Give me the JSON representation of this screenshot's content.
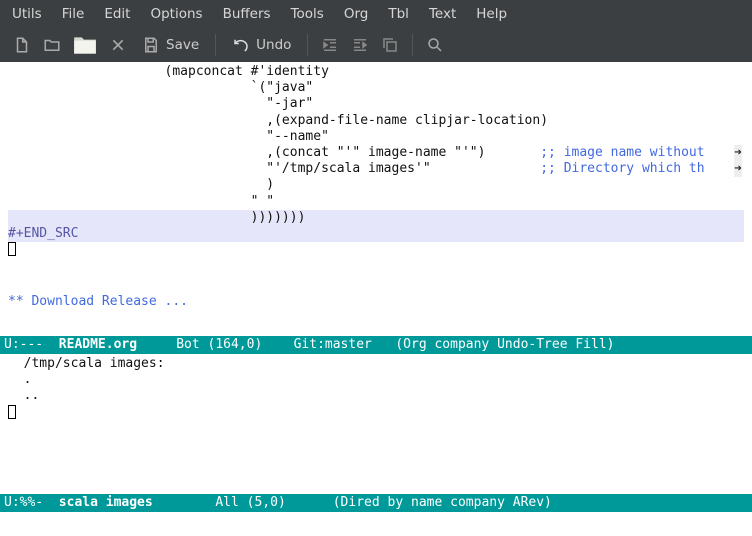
{
  "menubar": {
    "items": [
      "Utils",
      "File",
      "Edit",
      "Options",
      "Buffers",
      "Tools",
      "Org",
      "Tbl",
      "Text",
      "Help"
    ]
  },
  "toolbar": {
    "save_label": "Save",
    "undo_label": "Undo"
  },
  "buffer1": {
    "lines": [
      "                    (mapconcat #'identity",
      "                               `(\"java\"",
      "                                 \"-jar\"",
      "                                 ,(expand-file-name clipjar-location)",
      "                                 \"--name\"",
      "                                 ,(concat \"'\" image-name \"'\")       ;; image name without",
      "                                 \"'/tmp/scala images'\"              ;; Directory which th",
      "                                 )",
      "                               \" \"",
      "                               )))))))",
      "#+END_SRC",
      "",
      "",
      "",
      "** Download Release ..."
    ]
  },
  "modeline1": {
    "status": "U:--- ",
    "name": " README.org ",
    "pos": "    Bot (164,0)    Git:master   (Org company Undo-Tree Fill)"
  },
  "buffer2": {
    "lines": [
      "  /tmp/scala images:",
      "  .",
      "  .."
    ]
  },
  "modeline2": {
    "status": "U:%%- ",
    "name": " scala images ",
    "pos": "       All (5,0)      (Dired by name company ARev)"
  }
}
